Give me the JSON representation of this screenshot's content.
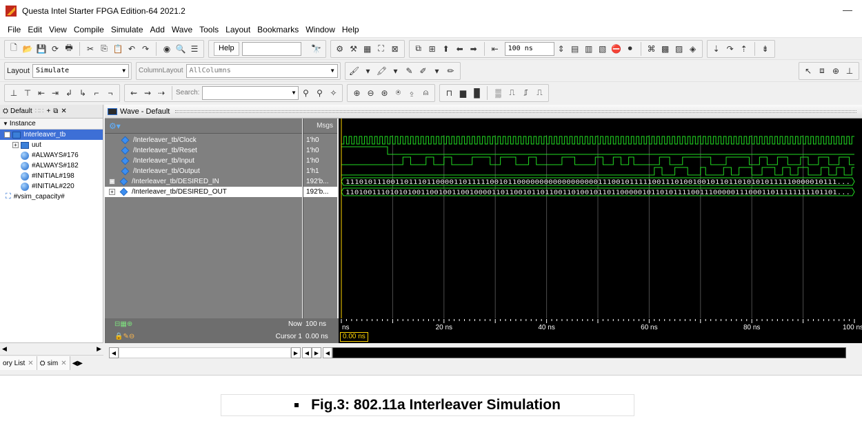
{
  "app": {
    "title": "Questa Intel Starter FPGA Edition-64 2021.2",
    "minimize_glyph": "—"
  },
  "menu": [
    "File",
    "Edit",
    "View",
    "Compile",
    "Simulate",
    "Add",
    "Wave",
    "Tools",
    "Layout",
    "Bookmarks",
    "Window",
    "Help"
  ],
  "toolbar": {
    "help_label": "Help",
    "run_time": "100 ns"
  },
  "layout": {
    "label": "Layout",
    "value": "Simulate",
    "column_label": "ColumnLayout",
    "column_value": "AllColumns"
  },
  "search": {
    "label": "Search:"
  },
  "instance_pane": {
    "header": "Default",
    "column": "Instance",
    "items": [
      {
        "label": "Interleaver_tb"
      },
      {
        "label": "uut"
      },
      {
        "label": "#ALWAYS#176"
      },
      {
        "label": "#ALWAYS#182"
      },
      {
        "label": "#INITIAL#198"
      },
      {
        "label": "#INITIAL#220"
      },
      {
        "label": "#vsim_capacity#"
      }
    ],
    "tabs": [
      "ory List",
      "sim"
    ]
  },
  "wave": {
    "title": "Wave - Default",
    "msgs_header": "Msgs",
    "signals": [
      {
        "name": "/Interleaver_tb/Clock",
        "value": "1'h0"
      },
      {
        "name": "/Interleaver_tb/Reset",
        "value": "1'h0"
      },
      {
        "name": "/Interleaver_tb/Input",
        "value": "1'h0"
      },
      {
        "name": "/Interleaver_tb/Output",
        "value": "1'h1"
      },
      {
        "name": "/Interleaver_tb/DESIRED_IN",
        "value": "192'b..."
      },
      {
        "name": "/Interleaver_tb/DESIRED_OUT",
        "value": "192'b..."
      }
    ],
    "bus_in_text": "1110101110011011101100001101111100101100000000000000000011100101111100111010010010110110101010111110000010111...",
    "bus_out_text": "110100111010101001100100110010000110110010110110011010010110110000010110101111001110000011100011011111111101101...",
    "now_label": "Now",
    "now_value": "100 ns",
    "cursor_label": "Cursor 1",
    "cursor_value": "0.00 ns",
    "cursor_badge": "0.00 ns",
    "time_ticks": [
      "ns",
      "20 ns",
      "40 ns",
      "60 ns",
      "80 ns",
      "100 ns"
    ],
    "time_range": [
      0,
      100
    ],
    "reset_high_until_ns": 9,
    "input_transitions_ns": [
      12,
      13.5,
      16.5,
      18,
      20,
      21.5,
      25.5,
      29,
      31,
      34,
      36.5,
      38,
      43,
      45.5,
      49.5,
      51,
      53,
      54.5,
      56,
      57,
      62,
      64,
      66.5,
      72,
      75,
      79.5,
      81.5,
      83,
      85,
      87,
      89.5,
      91,
      93,
      95,
      97,
      99
    ],
    "output_transitions_ns": [
      61,
      62.5,
      65,
      67.5,
      70,
      71,
      74.5,
      76,
      77.5,
      80,
      82,
      84.5,
      86,
      87.5,
      89,
      91,
      93.5,
      95,
      96.5,
      98,
      99.5
    ],
    "colors": {
      "signal": "#22dd22",
      "bus": "#e8e8e8",
      "grid": "#4d4d4d",
      "cursor": "#ffd400"
    }
  },
  "caption": "Fig.3: 802.11a Interleaver Simulation"
}
